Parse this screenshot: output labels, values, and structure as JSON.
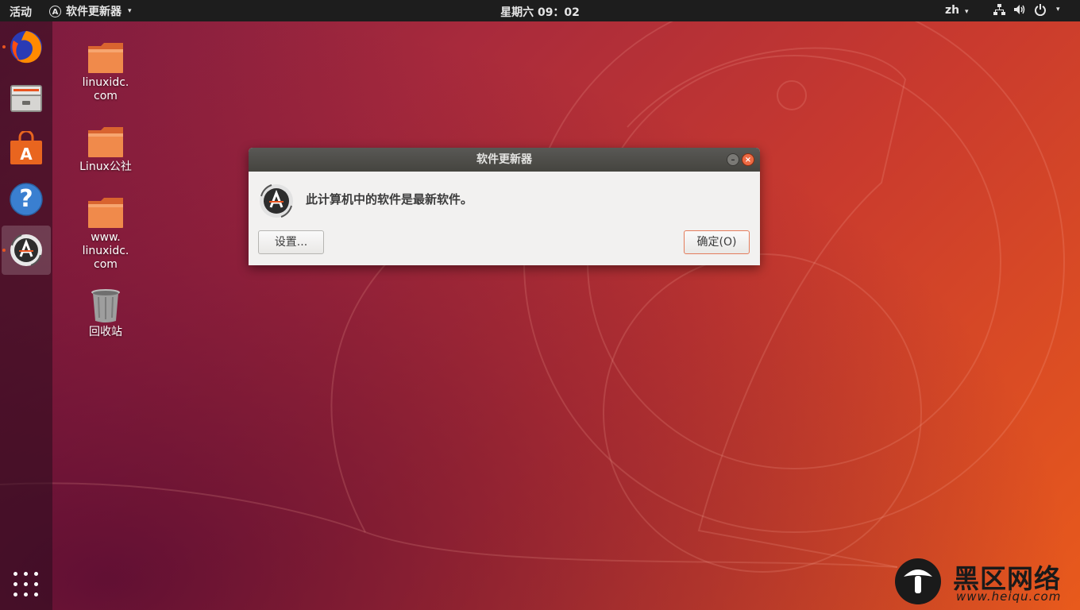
{
  "topbar": {
    "activities": "活动",
    "app_name": "软件更新器",
    "app_icon_glyph": "A",
    "clock": "星期六 09：02",
    "lang": "zh",
    "caret": "▾"
  },
  "dock": {
    "items": [
      {
        "name": "firefox",
        "running": true
      },
      {
        "name": "files",
        "running": false
      },
      {
        "name": "software-center",
        "running": false
      },
      {
        "name": "help",
        "running": false
      },
      {
        "name": "software-updater",
        "running": true,
        "active": true
      }
    ],
    "help_glyph": "?"
  },
  "desktop": {
    "icons": [
      {
        "label": "linuxidc.\ncom",
        "kind": "folder"
      },
      {
        "label": "Linux公社",
        "kind": "folder"
      },
      {
        "label": "www.\nlinuxidc.\ncom",
        "kind": "folder"
      },
      {
        "label": "回收站",
        "kind": "trash"
      }
    ]
  },
  "dialog": {
    "title": "软件更新器",
    "message": "此计算机中的软件是最新软件。",
    "settings_button": "设置...",
    "ok_button": "确定(O)",
    "minimize_glyph": "–",
    "close_glyph": "×"
  },
  "watermark": {
    "text": "黑区网络",
    "url": "www.heiqu.com"
  },
  "colors": {
    "accent": "#e95420",
    "topbar": "#1d1d1d",
    "dialog_bg": "#f2f1f0",
    "titlebar": "#4f4e4a"
  }
}
